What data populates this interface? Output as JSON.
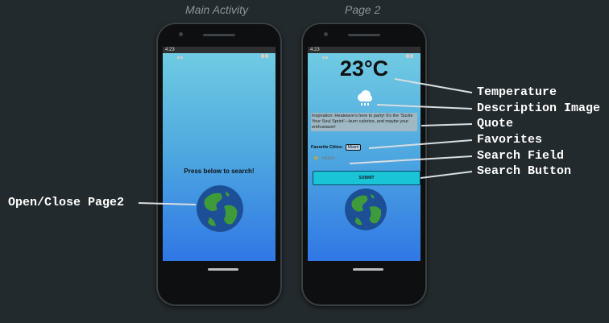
{
  "captions": {
    "main": "Main Activity",
    "page2": "Page 2"
  },
  "main_screen": {
    "status_time": "4:23",
    "prompt": "Press below to search!",
    "globe_icon": "earth-globe-icon"
  },
  "page2_screen": {
    "status_time": "4:23",
    "temperature": "23°C",
    "weather_icon": "cloud-rain-icon",
    "quote": "Inspiration: Heatwave's here to party! It's the 'Sizzle Your Soul Sprint'—burn calories, and maybe your enthusiasm!",
    "favorites_label": "Favorite Cities:",
    "favorites_selected": "Miami",
    "search_placeholder": "Miami",
    "search_button": "SUBMIT",
    "star_icon": "star-icon",
    "globe_icon": "earth-globe-icon"
  },
  "annotations": {
    "temperature": "Temperature",
    "description_image": "Description Image",
    "quote": "Quote",
    "favorites": "Favorites",
    "search_field": "Search Field",
    "search_button": "Search Button",
    "open_close": "Open/Close Page2"
  },
  "colors": {
    "background": "#232a2d",
    "screen_gradient_top": "#72cde2",
    "screen_gradient_bottom": "#2b6fe6",
    "button": "#19c4d7",
    "globe_ocean": "#1d4f96",
    "globe_land": "#3f9a3a"
  }
}
